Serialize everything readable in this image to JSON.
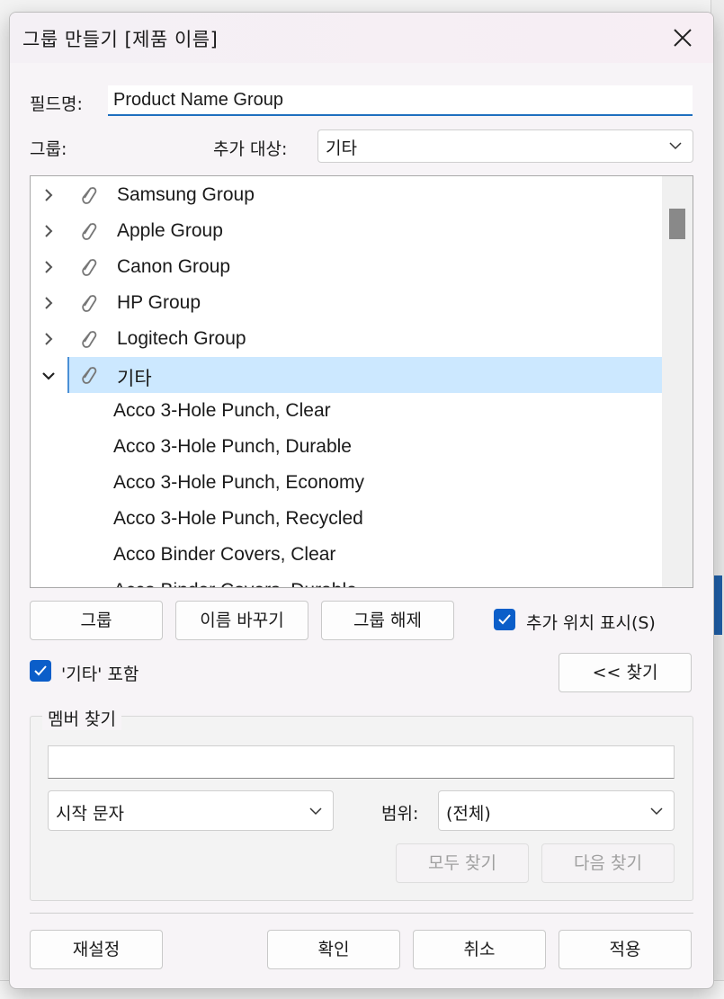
{
  "dialog": {
    "title": "그룹 만들기 [제품 이름]"
  },
  "field_name": {
    "label": "필드명:",
    "value": "Product Name Group"
  },
  "group_row": {
    "label": "그룹:",
    "add_target_label": "추가 대상:",
    "add_target_value": "기타"
  },
  "tree": {
    "groups": [
      {
        "label": "Samsung Group",
        "expanded": false
      },
      {
        "label": "Apple Group",
        "expanded": false
      },
      {
        "label": "Canon Group",
        "expanded": false
      },
      {
        "label": "HP Group",
        "expanded": false
      },
      {
        "label": "Logitech Group",
        "expanded": false
      },
      {
        "label": "기타",
        "expanded": true,
        "selected": true
      }
    ],
    "members": [
      "Acco 3-Hole Punch, Clear",
      "Acco 3-Hole Punch, Durable",
      "Acco 3-Hole Punch, Economy",
      "Acco 3-Hole Punch, Recycled",
      "Acco Binder Covers, Clear",
      "Acco Binder Covers, Durable"
    ]
  },
  "actions": {
    "group": "그룹",
    "rename": "이름 바꾸기",
    "ungroup": "그룹 해제",
    "show_add_location": "추가 위치 표시(S)",
    "show_add_location_checked": true,
    "include_other": "'기타' 포함",
    "include_other_checked": true,
    "find_toggle": "<< 찾기"
  },
  "find_members": {
    "title": "멤버 찾기",
    "search_value": "",
    "match_mode": "시작 문자",
    "scope_label": "범위:",
    "scope_value": "(전체)",
    "find_all": "모두 찾기",
    "find_next": "다음 찾기"
  },
  "footer": {
    "reset": "재설정",
    "ok": "확인",
    "cancel": "취소",
    "apply": "적용"
  },
  "colors": {
    "accent": "#0b5ec9",
    "selection": "#cce8ff"
  }
}
